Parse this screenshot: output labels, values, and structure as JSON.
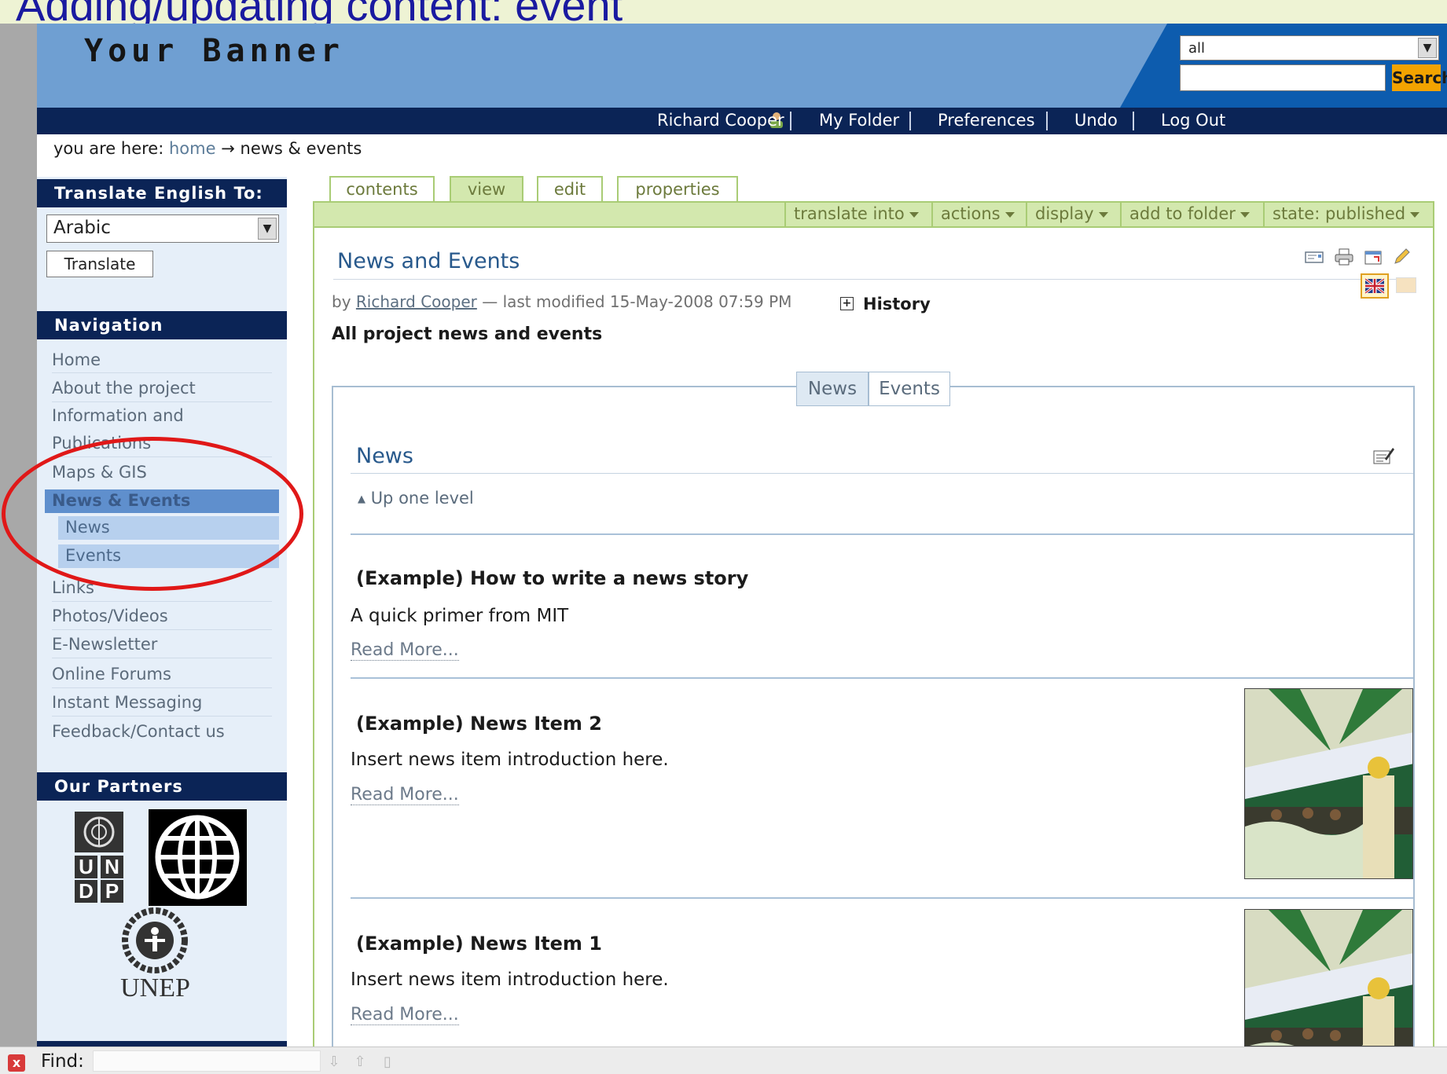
{
  "slide": {
    "title": "Adding/updating content: event"
  },
  "banner": {
    "title": "Your Banner",
    "search": {
      "scope_value": "all",
      "query": "",
      "button_label": "Search"
    }
  },
  "personal_bar": {
    "user": "Richard Cooper",
    "items": [
      "My Folder",
      "Preferences",
      "Undo",
      "Log Out"
    ]
  },
  "breadcrumb": {
    "prefix": "you are here:",
    "home": "home",
    "arrow": "→",
    "current": "news & events"
  },
  "translate": {
    "heading": "Translate English To:",
    "language": "Arabic",
    "button_label": "Translate"
  },
  "navigation": {
    "heading": "Navigation",
    "items_top": [
      "Home",
      "About the project",
      "Information and",
      "Publications",
      "Maps & GIS"
    ],
    "active": "News & Events",
    "sub_items": [
      "News",
      "Events"
    ],
    "items_bottom": [
      "Links",
      "Photos/Videos",
      "E-Newsletter",
      "Online Forums",
      "Instant Messaging",
      "Feedback/Contact us"
    ]
  },
  "partners": {
    "heading": "Our Partners",
    "undp_letters": [
      "U",
      "N",
      "D",
      "P"
    ],
    "unep_label": "UNEP"
  },
  "content_tabs": {
    "tabs": [
      "contents",
      "view",
      "edit",
      "properties"
    ],
    "active": "view"
  },
  "action_bar": {
    "items": [
      "translate into",
      "actions",
      "display",
      "add to folder",
      "state: published"
    ]
  },
  "document": {
    "title": "News and Events",
    "byline_by": "by",
    "author": "Richard Cooper",
    "byline_rest": "— last modified 15-May-2008 07:59 PM",
    "history_toggle": "+",
    "history_label": "History",
    "description": "All project news and events"
  },
  "news_events_toggle": {
    "news": "News",
    "events": "Events"
  },
  "news_section": {
    "heading": "News",
    "up_one_level": "Up one level",
    "items": [
      {
        "title": "(Example) How to write a news story",
        "description": "A quick primer from MIT",
        "more": "Read More..."
      },
      {
        "title": "(Example) News Item 2",
        "description": "Insert news item introduction here.",
        "more": "Read More..."
      },
      {
        "title": "(Example) News Item 1",
        "description": "Insert news item introduction here.",
        "more": "Read More..."
      }
    ]
  },
  "find_bar": {
    "close": "x",
    "label": "Find:",
    "query": ""
  },
  "colors": {
    "banner_blue": "#6f9fd2",
    "nav_dark": "#0b2456",
    "search_orange": "#f3a300",
    "tab_green": "#d3e8ae",
    "annotation_red": "#e01818"
  }
}
